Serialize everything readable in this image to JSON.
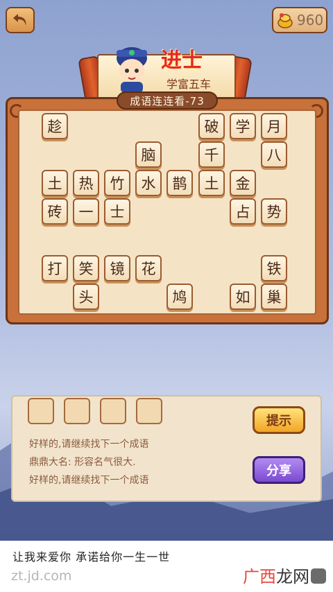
{
  "header": {
    "coins": "960"
  },
  "rank": {
    "title": "进士",
    "subtitle": "学富五车"
  },
  "level": {
    "label": "成语连连看-73"
  },
  "board": {
    "tiles": [
      {
        "ch": "趁",
        "r": 0,
        "c": 0
      },
      {
        "ch": "破",
        "r": 0,
        "c": 6
      },
      {
        "ch": "学",
        "r": 0,
        "c": 7
      },
      {
        "ch": "月",
        "r": 0,
        "c": 8
      },
      {
        "ch": "脑",
        "r": 1,
        "c": 3
      },
      {
        "ch": "千",
        "r": 1,
        "c": 6
      },
      {
        "ch": "八",
        "r": 1,
        "c": 8
      },
      {
        "ch": "土",
        "r": 2,
        "c": 0
      },
      {
        "ch": "热",
        "r": 2,
        "c": 1
      },
      {
        "ch": "竹",
        "r": 2,
        "c": 2
      },
      {
        "ch": "水",
        "r": 2,
        "c": 3
      },
      {
        "ch": "鹊",
        "r": 2,
        "c": 4
      },
      {
        "ch": "土",
        "r": 2,
        "c": 5
      },
      {
        "ch": "金",
        "r": 2,
        "c": 6
      },
      {
        "ch": "砖",
        "r": 3,
        "c": 0
      },
      {
        "ch": "一",
        "r": 3,
        "c": 1
      },
      {
        "ch": "士",
        "r": 3,
        "c": 2
      },
      {
        "ch": "占",
        "r": 3,
        "c": 6
      },
      {
        "ch": "势",
        "r": 3,
        "c": 8
      },
      {
        "ch": "打",
        "r": 5,
        "c": 0
      },
      {
        "ch": "笑",
        "r": 5,
        "c": 1
      },
      {
        "ch": "镜",
        "r": 5,
        "c": 2
      },
      {
        "ch": "花",
        "r": 5,
        "c": 3
      },
      {
        "ch": "铁",
        "r": 5,
        "c": 8
      },
      {
        "ch": "头",
        "r": 6,
        "c": 1
      },
      {
        "ch": "鸠",
        "r": 6,
        "c": 4
      },
      {
        "ch": "如",
        "r": 6,
        "c": 7
      },
      {
        "ch": "巢",
        "r": 6,
        "c": 8
      }
    ]
  },
  "answer": {
    "slots": 4
  },
  "messages": [
    "好样的,请继续找下一个成语",
    "鼎鼎大名: 形容名气很大.",
    "好样的,请继续找下一个成语"
  ],
  "buttons": {
    "hint": "提示",
    "share": "分享"
  },
  "ad": {
    "line": "让我来爱你 承诺给你一生一世",
    "url": "zt.jd.com",
    "brand_red": "广西",
    "brand_dark": "龙网"
  },
  "colors": {
    "board_frame": "#c8713a",
    "board_inner": "#f5e3c5",
    "tile_text": "#4a2a1a",
    "rank_red": "#e8262a"
  }
}
